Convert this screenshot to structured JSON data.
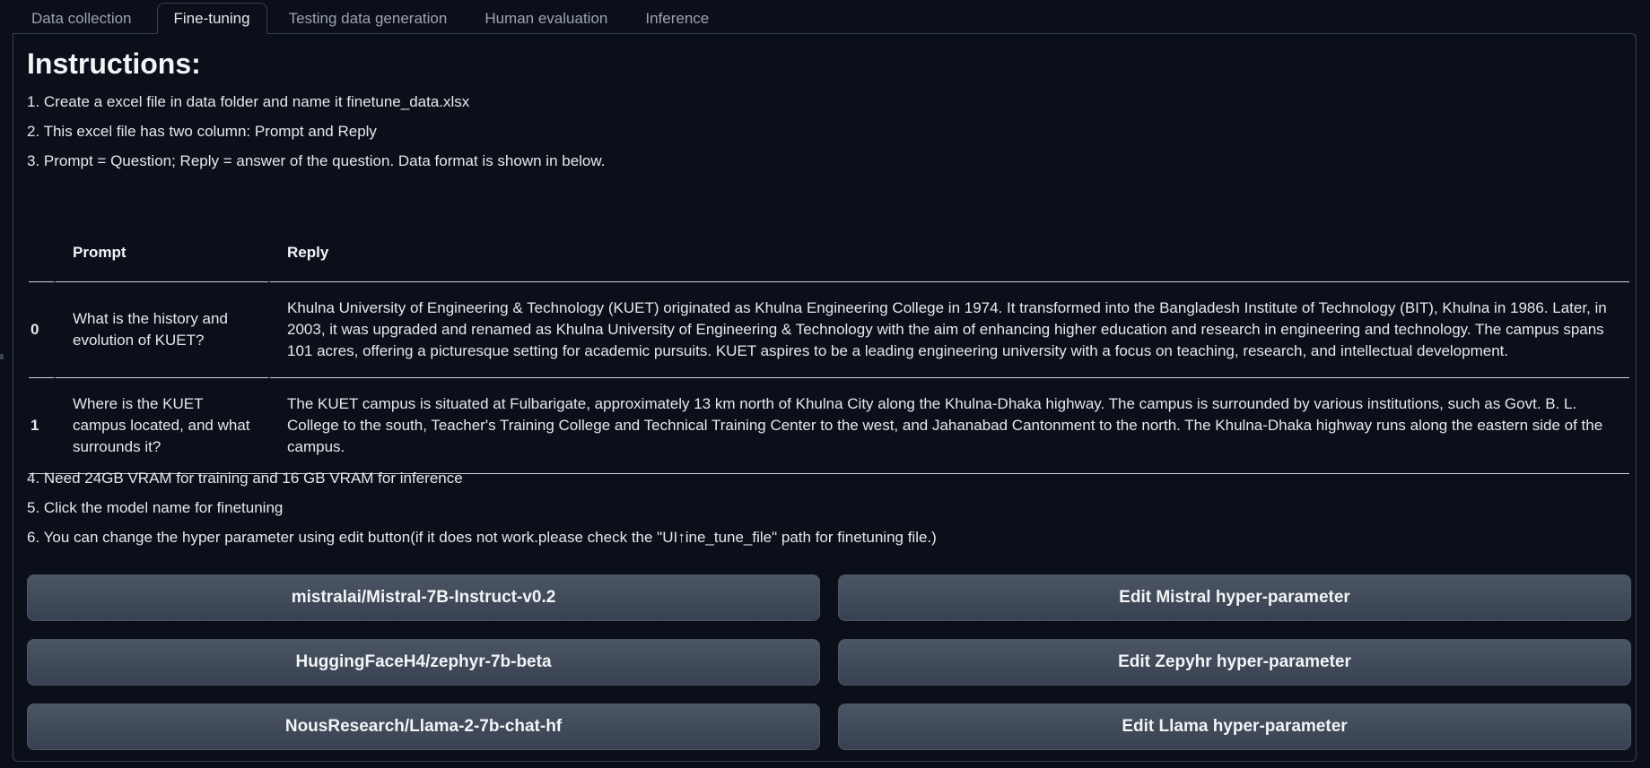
{
  "tabs": [
    {
      "label": "Data collection"
    },
    {
      "label": "Fine-tuning"
    },
    {
      "label": "Testing data generation"
    },
    {
      "label": "Human evaluation"
    },
    {
      "label": "Inference"
    }
  ],
  "active_tab": "Fine-tuning",
  "instructions": {
    "heading": "Instructions:",
    "step1": "1. Create a excel file in data folder and name it finetune_data.xlsx",
    "step2": "2. This excel file has two column: Prompt and Reply",
    "step3": "3. Prompt = Question; Reply = answer of the question. Data format is shown in below.",
    "step4": "4. Need 24GB VRAM for training and 16 GB VRAM for inference",
    "step5": "5. Click the model name for finetuning",
    "step6": "6. You can change the hyper parameter using edit button(if it does not work.please check the \"UI↑ine_tune_file\" path for finetuning file.)"
  },
  "table": {
    "headers": {
      "index": "",
      "prompt": "Prompt",
      "reply": "Reply"
    },
    "rows": [
      {
        "index": "0",
        "prompt": "What is the history and evolution of KUET?",
        "reply": "Khulna University of Engineering & Technology (KUET) originated as Khulna Engineering College in 1974. It transformed into the Bangladesh Institute of Technology (BIT), Khulna in 1986. Later, in 2003, it was upgraded and renamed as Khulna University of Engineering & Technology with the aim of enhancing higher education and research in engineering and technology. The campus spans 101 acres, offering a picturesque setting for academic pursuits. KUET aspires to be a leading engineering university with a focus on teaching, research, and intellectual development."
      },
      {
        "index": "1",
        "prompt": "Where is the KUET campus located, and what surrounds it?",
        "reply": "The KUET campus is situated at Fulbarigate, approximately 13 km north of Khulna City along the Khulna-Dhaka highway. The campus is surrounded by various institutions, such as Govt. B. L. College to the south, Teacher's Training College and Technical Training Center to the west, and Jahanabad Cantonment to the north. The Khulna-Dhaka highway runs along the eastern side of the campus."
      }
    ]
  },
  "buttons": {
    "mistral_model": "mistralai/Mistral-7B-Instruct-v0.2",
    "mistral_edit": "Edit Mistral hyper-parameter",
    "zephyr_model": "HuggingFaceH4/zephyr-7b-beta",
    "zephyr_edit": "Edit Zepyhr hyper-parameter",
    "llama_model": "NousResearch/Llama-2-7b-chat-hf",
    "llama_edit": "Edit Llama hyper-parameter"
  },
  "colors": {
    "background": "#0b0f19",
    "border": "#374151",
    "button": "#4b5563",
    "text": "#e5e7eb",
    "muted_text": "#9ca3af"
  }
}
